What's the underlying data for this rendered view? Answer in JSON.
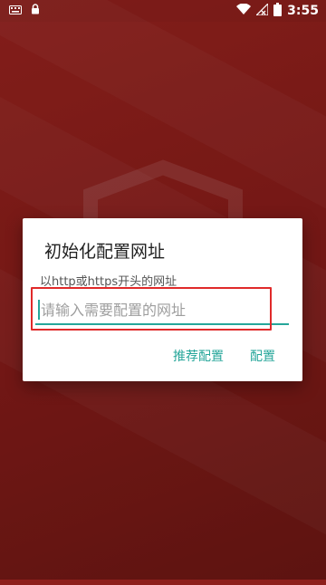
{
  "status_bar": {
    "time": "3:55",
    "left_icons": [
      "keyboard-icon",
      "lock-icon"
    ],
    "right_icons": [
      "wifi-icon",
      "no-signal-icon",
      "battery-icon"
    ]
  },
  "dialog": {
    "title": "初始化配置网址",
    "hint": "以http或https开头的网址",
    "input": {
      "value": "",
      "placeholder": "请输入需要配置的网址"
    },
    "buttons": {
      "recommend_label": "推荐配置",
      "config_label": "配置"
    }
  },
  "colors": {
    "background": "#8e1f1c",
    "accent": "#26a69a",
    "highlight": "#e02a2a"
  }
}
